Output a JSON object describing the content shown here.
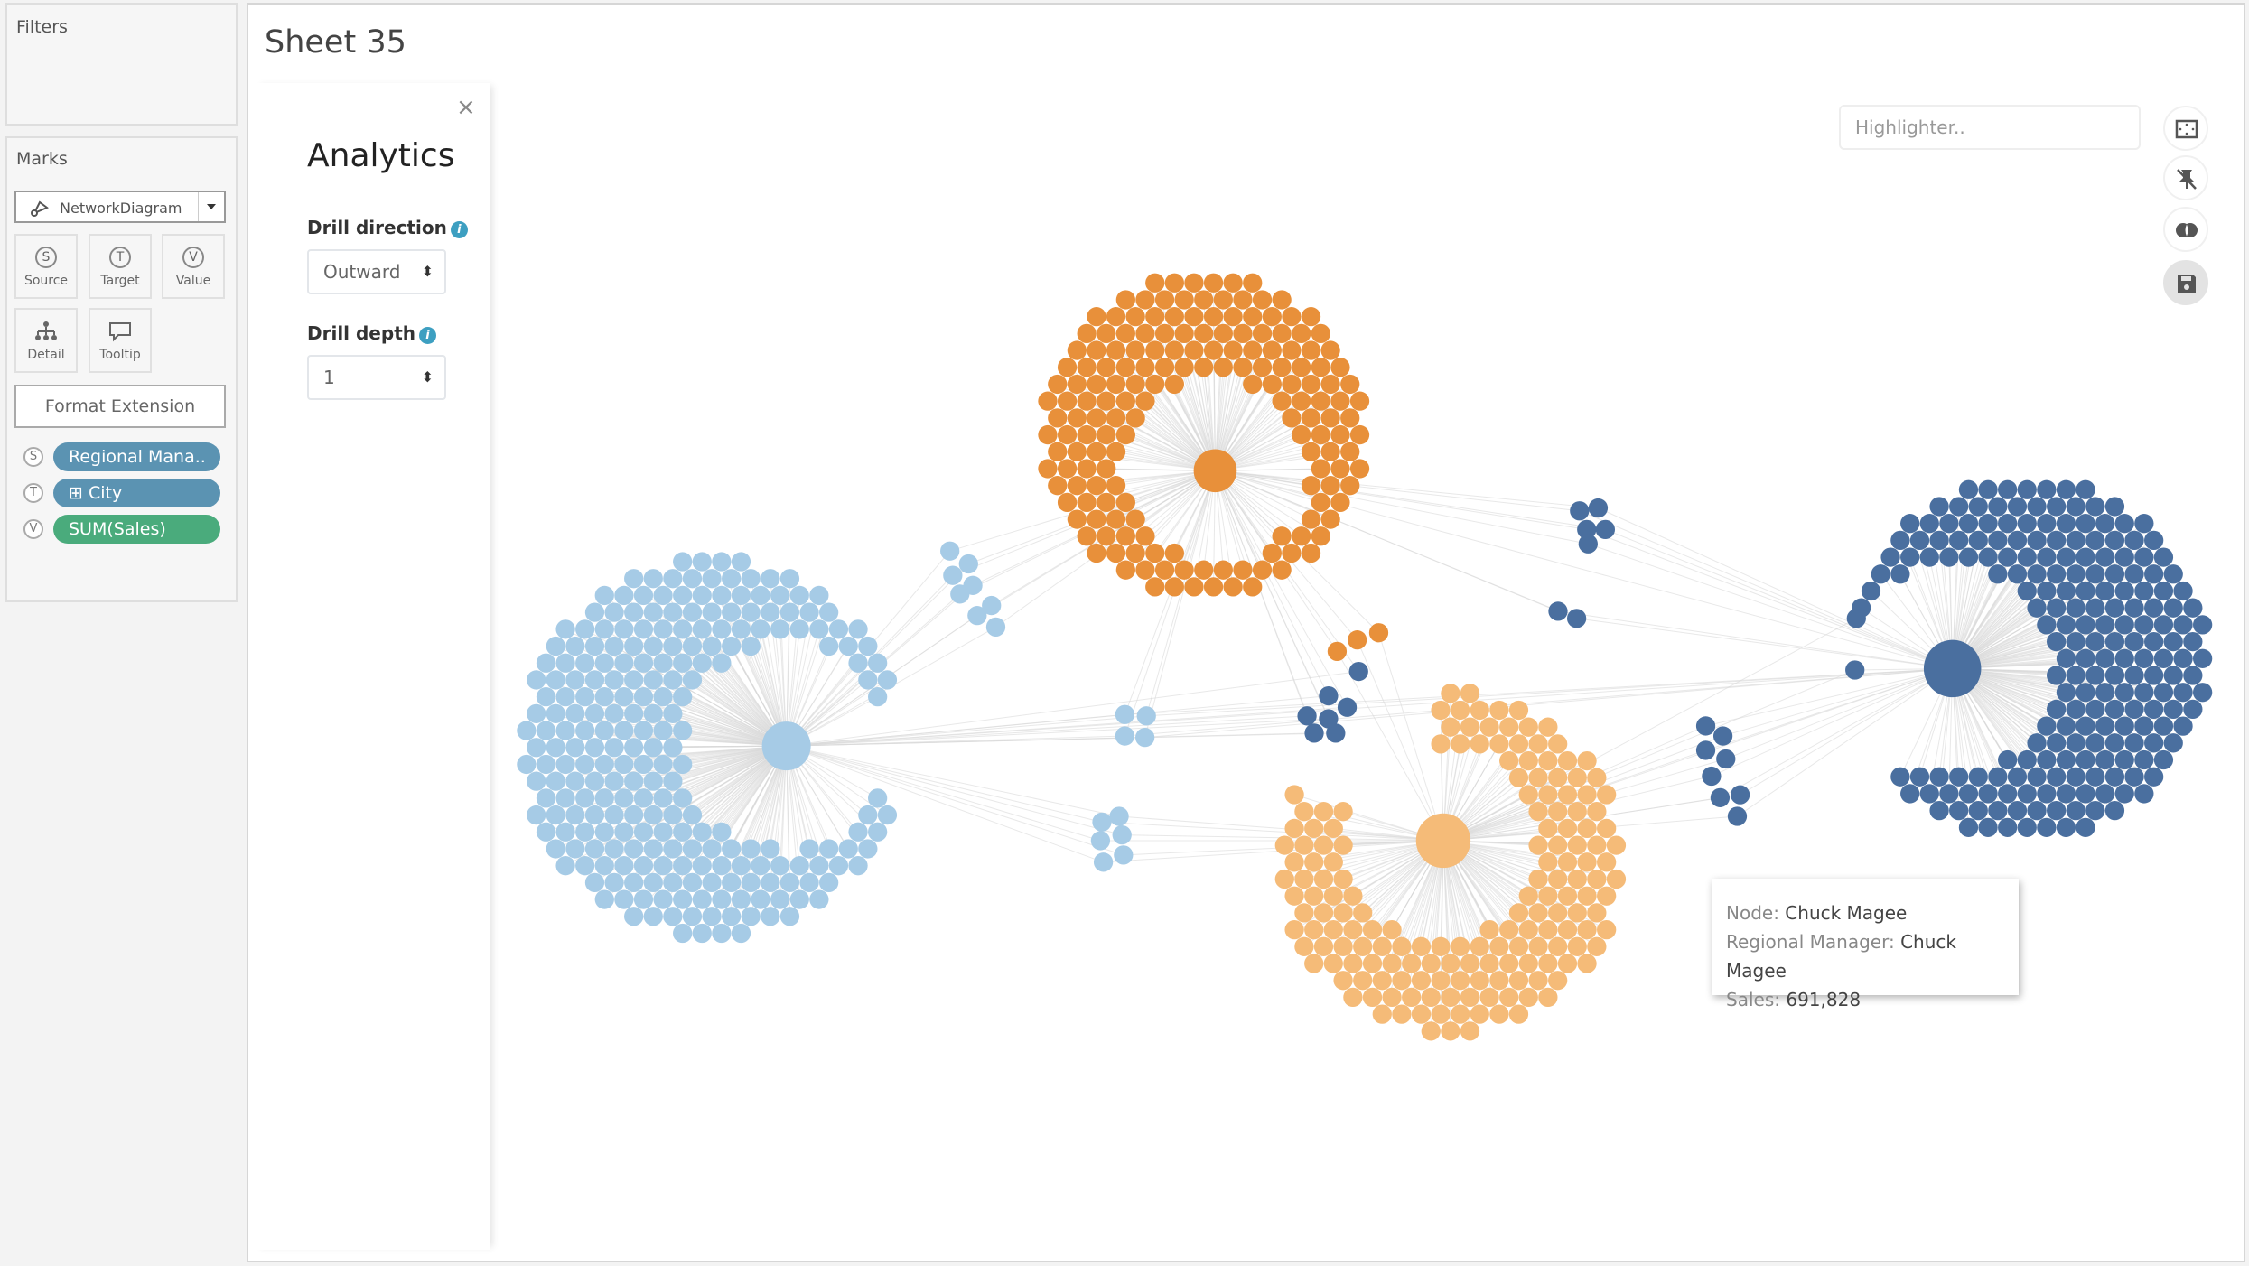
{
  "sidebar": {
    "filters_label": "Filters",
    "marks_label": "Marks",
    "mark_type": "NetworkDiagram",
    "mark_buttons": [
      {
        "label": "Source",
        "glyph": "S"
      },
      {
        "label": "Target",
        "glyph": "T"
      },
      {
        "label": "Value",
        "glyph": "V"
      },
      {
        "label": "Detail",
        "icon": "hierarchy-icon"
      },
      {
        "label": "Tooltip",
        "icon": "speech-bubble-icon"
      }
    ],
    "format_extension": "Format Extension",
    "pills": [
      {
        "glyph": "S",
        "label": "Regional Mana..",
        "color": "#5b93b2"
      },
      {
        "glyph": "T",
        "label": "⊞ City",
        "color": "#5b93b2"
      },
      {
        "glyph": "V",
        "label": "SUM(Sales)",
        "color": "#4aab7c"
      }
    ]
  },
  "sheet": {
    "title": "Sheet 35"
  },
  "analytics": {
    "close": "×",
    "title": "Analytics",
    "drill_direction_label": "Drill direction",
    "drill_direction_value": "Outward",
    "drill_depth_label": "Drill depth",
    "drill_depth_value": "1",
    "info": "i"
  },
  "toolbar": {
    "highlighter_placeholder": "Highlighter..",
    "tools": [
      "fit-screen-icon",
      "unpin-icon",
      "overlap-icon",
      "save-icon"
    ]
  },
  "network": {
    "colors": {
      "light_blue": "#a6cbe6",
      "orange": "#e8903a",
      "dark_blue": "#4a6f9f",
      "peach": "#f5bb78",
      "edge": "#d9d9d9"
    }
  },
  "tooltip": {
    "node_label": "Node:",
    "node_value": "Chuck Magee",
    "manager_label": "Regional Manager:",
    "manager_value": "Chuck Magee",
    "sales_label": "Sales:",
    "sales_value": "691,828"
  }
}
